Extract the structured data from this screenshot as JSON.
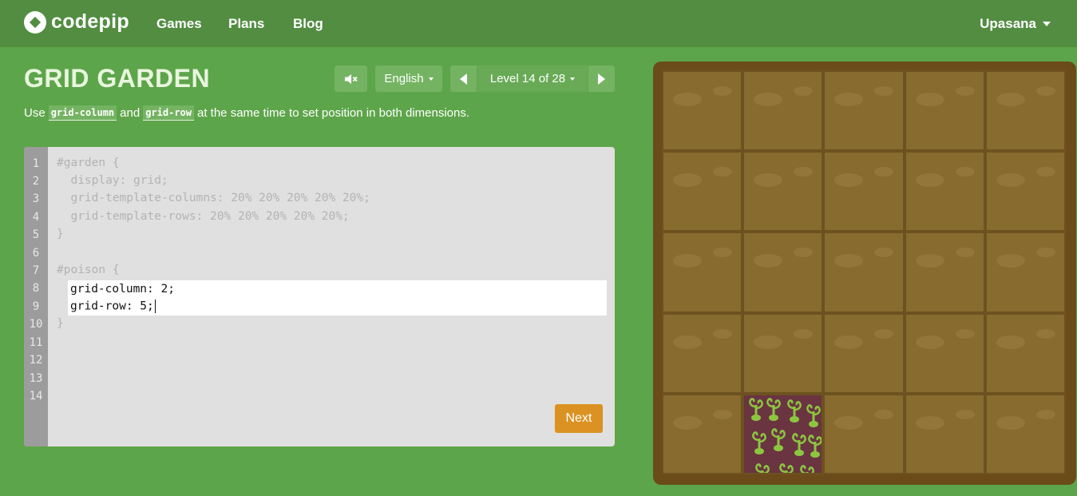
{
  "nav": {
    "logo_text": "codepip",
    "links": [
      "Games",
      "Plans",
      "Blog"
    ],
    "user": "Upasana"
  },
  "page": {
    "title": "GRID GARDEN",
    "language": "English",
    "level": "Level 14 of 28",
    "instructions": {
      "prefix": "Use",
      "code1": "grid-column",
      "middle": "and",
      "code2": "grid-row",
      "suffix": "at the same time to set position in both dimensions."
    }
  },
  "editor": {
    "line_numbers": [
      "1",
      "2",
      "3",
      "4",
      "5",
      "6",
      "7",
      "8",
      "9",
      "10",
      "11",
      "12",
      "13",
      "14"
    ],
    "lines_before": [
      "#garden {",
      "  display: grid;",
      "  grid-template-columns: 20% 20% 20% 20% 20%;",
      "  grid-template-rows: 20% 20% 20% 20% 20%;",
      "}",
      "",
      "#poison {"
    ],
    "input_lines": [
      "grid-column: 2;",
      "grid-row: 5;"
    ],
    "lines_after": [
      "}"
    ],
    "next_label": "Next"
  },
  "garden": {
    "columns": 5,
    "rows": 5,
    "poison_column": 2,
    "poison_row": 5,
    "colors": {
      "soil": "#876b2f",
      "frame": "#6a4b19",
      "poison": "#6a3441",
      "weed": "#8cc63f"
    }
  }
}
